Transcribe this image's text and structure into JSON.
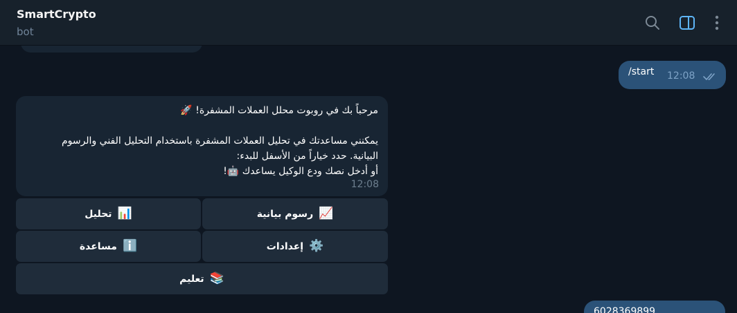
{
  "header": {
    "title": "SmartCrypto",
    "subtitle": "bot",
    "icons": [
      "search-icon",
      "sidebar-toggle-icon",
      "more-vertical-icon"
    ],
    "accent": "#5eb5f7"
  },
  "messages": {
    "outgoing_start": {
      "text": "/start",
      "time": "12:08",
      "status": "read"
    },
    "incoming_welcome": {
      "lines": [
        "مرحباً بك في روبوت محلل العملات المشفرة! 🚀",
        "",
        "يمكنني مساعدتك في تحليل العملات المشفرة باستخدام التحليل الفني والرسوم",
        "البيانية. حدد خياراً من الأسفل للبدء:",
        "أو أدخل نصك ودع الوكيل يساعدك 🤖!"
      ],
      "time": "12:08"
    },
    "outgoing_partial": {
      "text": "6028369899"
    }
  },
  "keyboard": {
    "charts": {
      "label": "رسوم بيانية",
      "emoji": "📈"
    },
    "analysis": {
      "label": "تحليل",
      "emoji": "📊"
    },
    "settings": {
      "label": "إعدادات",
      "emoji": "⚙️"
    },
    "help": {
      "label": "مساعدة",
      "emoji": "ℹ️"
    },
    "learn": {
      "label": "تعليم",
      "emoji": "📚"
    }
  },
  "colors": {
    "background": "#0e1621",
    "header": "#17212b",
    "incoming_bubble": "#182533",
    "outgoing_bubble": "#2b5278",
    "keyboard_button": "#1f2c3a"
  }
}
